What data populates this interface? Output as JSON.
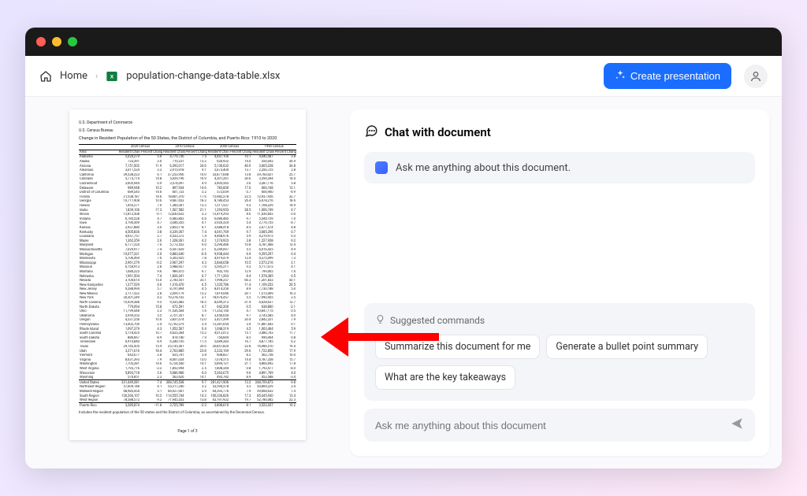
{
  "breadcrumb": {
    "home": "Home",
    "file": "population-change-data-table.xlsx"
  },
  "toolbar": {
    "create": "Create presentation"
  },
  "chat": {
    "title": "Chat with document",
    "greeting": "Ask me anything about this document.",
    "suggested_label": "Suggested commands",
    "suggestions": [
      "Summarize this document for me",
      "Generate a bullet point summary",
      "What are the key takeaways"
    ],
    "placeholder": "Ask me anything about this document"
  },
  "document": {
    "agency1": "U.S. Department of Commerce",
    "agency2": "U.S. Census Bureau",
    "title": "Change in Resident Population of the 50 States, the District of Columbia, and Puerto Rico: 1910 to 2020",
    "col_groups": [
      "2020 Census",
      "2010 Census",
      "2000 Census",
      "1990 Census"
    ],
    "col_headers": [
      "Area",
      "Resident Change",
      "Percent Change",
      "Resident Change",
      "Percent Change",
      "Resident Change",
      "Percent Change",
      "Resident Change",
      "Percent Change"
    ],
    "rows": [
      [
        "Alabama",
        "5,024,279",
        "5.0",
        "4,779,736",
        "7.5",
        "4,447,100",
        "10.1",
        "4,040,587",
        "3.8"
      ],
      [
        "Alaska",
        "733,391",
        "3.0",
        "710,231",
        "13.3",
        "626,932",
        "14.0",
        "550,043",
        "36.9"
      ],
      [
        "Arizona",
        "7,151,502",
        "11.9",
        "6,392,017",
        "24.6",
        "5,130,632",
        "40.0",
        "3,665,228",
        "34.8"
      ],
      [
        "Arkansas",
        "3,011,524",
        "3.3",
        "2,915,918",
        "9.1",
        "2,673,400",
        "13.7",
        "2,350,725",
        "2.8"
      ],
      [
        "California",
        "39,538,223",
        "6.1",
        "37,253,956",
        "10.0",
        "33,871,648",
        "13.8",
        "29,760,021",
        "25.7"
      ],
      [
        "Colorado",
        "5,773,714",
        "14.8",
        "5,029,196",
        "16.9",
        "4,301,261",
        "30.6",
        "3,294,394",
        "14.0"
      ],
      [
        "Connecticut",
        "3,605,944",
        "0.9",
        "3,574,097",
        "4.9",
        "3,405,565",
        "3.6",
        "3,287,116",
        "5.8"
      ],
      [
        "Delaware",
        "989,948",
        "10.2",
        "897,934",
        "14.6",
        "783,600",
        "17.6",
        "666,168",
        "12.1"
      ],
      [
        "District of Columbia",
        "689,545",
        "14.6",
        "601,723",
        "5.2",
        "572,059",
        "-5.7",
        "606,900",
        "-4.9"
      ],
      [
        "Florida",
        "21,538,187",
        "14.6",
        "18,801,310",
        "17.6",
        "15,982,378",
        "23.5",
        "12,937,926",
        "32.7"
      ],
      [
        "Georgia",
        "10,711,908",
        "10.6",
        "9,687,653",
        "18.3",
        "8,186,453",
        "26.4",
        "6,478,216",
        "18.6"
      ],
      [
        "Hawaii",
        "1,455,271",
        "7.0",
        "1,360,301",
        "12.3",
        "1,211,537",
        "9.3",
        "1,108,229",
        "14.9"
      ],
      [
        "Idaho",
        "1,839,106",
        "17.3",
        "1,567,582",
        "21.1",
        "1,293,953",
        "28.5",
        "1,006,749",
        "6.7"
      ],
      [
        "Illinois",
        "12,812,508",
        "-0.1",
        "12,830,632",
        "3.3",
        "12,419,293",
        "8.6",
        "11,430,602",
        "0.0"
      ],
      [
        "Indiana",
        "6,785,528",
        "4.7",
        "6,483,802",
        "6.6",
        "6,080,485",
        "9.7",
        "5,544,159",
        "1.0"
      ],
      [
        "Iowa",
        "3,190,369",
        "4.7",
        "3,046,355",
        "4.1",
        "2,926,324",
        "5.4",
        "2,776,755",
        "-4.7"
      ],
      [
        "Kansas",
        "2,937,880",
        "3.0",
        "2,853,118",
        "6.1",
        "2,688,418",
        "8.5",
        "2,477,574",
        "4.8"
      ],
      [
        "Kentucky",
        "4,505,836",
        "3.8",
        "4,339,367",
        "7.4",
        "4,041,769",
        "9.7",
        "3,685,296",
        "0.7"
      ],
      [
        "Louisiana",
        "4,657,757",
        "2.7",
        "4,533,372",
        "1.4",
        "4,468,976",
        "5.9",
        "4,219,973",
        "0.3"
      ],
      [
        "Maine",
        "1,362,359",
        "2.6",
        "1,328,361",
        "4.2",
        "1,274,923",
        "3.8",
        "1,227,928",
        "9.2"
      ],
      [
        "Maryland",
        "6,177,224",
        "7.0",
        "5,773,552",
        "9.0",
        "5,296,486",
        "10.8",
        "4,781,468",
        "13.4"
      ],
      [
        "Massachusetts",
        "7,029,917",
        "7.4",
        "6,547,629",
        "3.1",
        "6,349,097",
        "5.5",
        "6,016,425",
        "4.9"
      ],
      [
        "Michigan",
        "10,077,331",
        "2.0",
        "9,883,640",
        "-0.6",
        "9,938,444",
        "6.9",
        "9,295,297",
        "0.4"
      ],
      [
        "Minnesota",
        "5,706,494",
        "7.6",
        "5,303,925",
        "7.8",
        "4,919,479",
        "12.4",
        "4,375,099",
        "7.3"
      ],
      [
        "Mississippi",
        "2,961,279",
        "-0.2",
        "2,967,297",
        "4.3",
        "2,844,658",
        "10.5",
        "2,573,216",
        "2.1"
      ],
      [
        "Missouri",
        "6,154,913",
        "2.8",
        "5,988,927",
        "7.0",
        "5,595,211",
        "9.3",
        "5,117,073",
        "4.1"
      ],
      [
        "Montana",
        "1,084,225",
        "9.6",
        "989,415",
        "9.7",
        "902,195",
        "12.9",
        "799,065",
        "1.6"
      ],
      [
        "Nebraska",
        "1,961,504",
        "7.4",
        "1,826,341",
        "6.7",
        "1,711,263",
        "8.4",
        "1,578,385",
        "0.5"
      ],
      [
        "Nevada",
        "3,104,614",
        "15.0",
        "2,700,551",
        "35.1",
        "1,998,257",
        "66.3",
        "1,201,833",
        "50.1"
      ],
      [
        "New Hampshire",
        "1,377,529",
        "4.6",
        "1,316,470",
        "6.5",
        "1,235,786",
        "11.4",
        "1,109,252",
        "20.5"
      ],
      [
        "New Jersey",
        "9,288,994",
        "5.7",
        "8,791,894",
        "4.5",
        "8,414,350",
        "8.9",
        "7,730,188",
        "5.0"
      ],
      [
        "New Mexico",
        "2,117,522",
        "2.8",
        "2,059,179",
        "13.2",
        "1,819,046",
        "20.1",
        "1,515,069",
        "16.3"
      ],
      [
        "New York",
        "20,201,249",
        "4.2",
        "19,378,102",
        "2.1",
        "18,976,457",
        "5.5",
        "17,990,455",
        "2.5"
      ],
      [
        "North Carolina",
        "10,439,388",
        "9.5",
        "9,535,483",
        "18.5",
        "8,049,313",
        "21.4",
        "6,628,637",
        "12.7"
      ],
      [
        "North Dakota",
        "779,094",
        "15.8",
        "672,591",
        "4.7",
        "642,200",
        "0.5",
        "638,800",
        "-2.1"
      ],
      [
        "Ohio",
        "11,799,448",
        "2.3",
        "11,536,504",
        "1.6",
        "11,353,140",
        "4.7",
        "10,847,115",
        "0.5"
      ],
      [
        "Oklahoma",
        "3,959,353",
        "5.5",
        "3,751,351",
        "8.7",
        "3,450,654",
        "9.7",
        "3,145,585",
        "4.0"
      ],
      [
        "Oregon",
        "4,237,256",
        "10.6",
        "3,831,074",
        "12.0",
        "3,421,399",
        "20.4",
        "2,842,321",
        "7.9"
      ],
      [
        "Pennsylvania",
        "13,002,700",
        "2.4",
        "12,702,379",
        "3.4",
        "12,281,054",
        "3.4",
        "11,881,643",
        "0.1"
      ],
      [
        "Rhode Island",
        "1,097,379",
        "4.3",
        "1,052,567",
        "0.4",
        "1,048,319",
        "4.5",
        "1,003,464",
        "5.9"
      ],
      [
        "South Carolina",
        "5,118,425",
        "10.7",
        "4,625,364",
        "15.3",
        "4,012,012",
        "15.1",
        "3,486,703",
        "11.7"
      ],
      [
        "South Dakota",
        "886,667",
        "8.9",
        "814,180",
        "7.9",
        "754,844",
        "8.5",
        "696,004",
        "0.8"
      ],
      [
        "Tennessee",
        "6,910,840",
        "8.9",
        "6,346,105",
        "11.5",
        "5,689,283",
        "16.7",
        "4,877,185",
        "6.2"
      ],
      [
        "Texas",
        "29,145,505",
        "15.9",
        "25,145,561",
        "20.6",
        "20,851,820",
        "22.8",
        "16,986,510",
        "19.4"
      ],
      [
        "Utah",
        "3,271,616",
        "18.4",
        "2,763,885",
        "23.8",
        "2,233,169",
        "29.6",
        "1,722,850",
        "17.9"
      ],
      [
        "Vermont",
        "643,077",
        "2.8",
        "625,741",
        "2.8",
        "608,827",
        "8.2",
        "562,758",
        "10.0"
      ],
      [
        "Virginia",
        "8,631,393",
        "7.9",
        "8,001,024",
        "13.0",
        "7,078,515",
        "14.4",
        "6,187,358",
        "15.7"
      ],
      [
        "Washington",
        "7,705,281",
        "14.6",
        "6,724,540",
        "14.1",
        "5,894,121",
        "21.1",
        "4,866,692",
        "17.8"
      ],
      [
        "West Virginia",
        "1,793,716",
        "-3.2",
        "1,852,994",
        "2.5",
        "1,808,344",
        "0.8",
        "1,793,477",
        "-8.0"
      ],
      [
        "Wisconsin",
        "5,893,718",
        "3.6",
        "5,686,986",
        "6.0",
        "5,363,675",
        "9.6",
        "4,891,769",
        "4.0"
      ],
      [
        "Wyoming",
        "576,851",
        "2.3",
        "563,626",
        "14.1",
        "493,782",
        "8.9",
        "453,588",
        "-3.4"
      ]
    ],
    "region_rows": [
      [
        "United States",
        "331,449,281",
        "7.4",
        "308,745,538",
        "9.7",
        "281,421,906",
        "13.2",
        "248,709,873",
        "9.8"
      ],
      [
        "Northeast Region",
        "57,609,148",
        "4.1",
        "55,317,240",
        "3.2",
        "53,594,378",
        "5.5",
        "50,809,229",
        "3.4"
      ],
      [
        "Midwest Region",
        "68,985,454",
        "3.1",
        "66,927,001",
        "3.9",
        "64,392,776",
        "7.9",
        "59,668,632",
        "1.4"
      ],
      [
        "South Region",
        "126,266,107",
        "10.2",
        "114,555,744",
        "14.3",
        "100,236,820",
        "17.3",
        "85,445,930",
        "13.4"
      ],
      [
        "West Region",
        "78,588,572",
        "9.2",
        "71,945,553",
        "13.8",
        "63,197,932",
        "19.7",
        "52,786,082",
        "22.3"
      ]
    ],
    "puerto_rico": [
      "Puerto Rico",
      "3,285,874",
      "-11.8",
      "3,725,789",
      "-2.2",
      "3,808,610",
      "8.1",
      "3,522,037",
      "10.2"
    ],
    "footnote": "Includes the resident population of the 50 states and the District of Columbia, as ascertained by the Decennial Census.",
    "page_label": "Page 1 of 3"
  }
}
